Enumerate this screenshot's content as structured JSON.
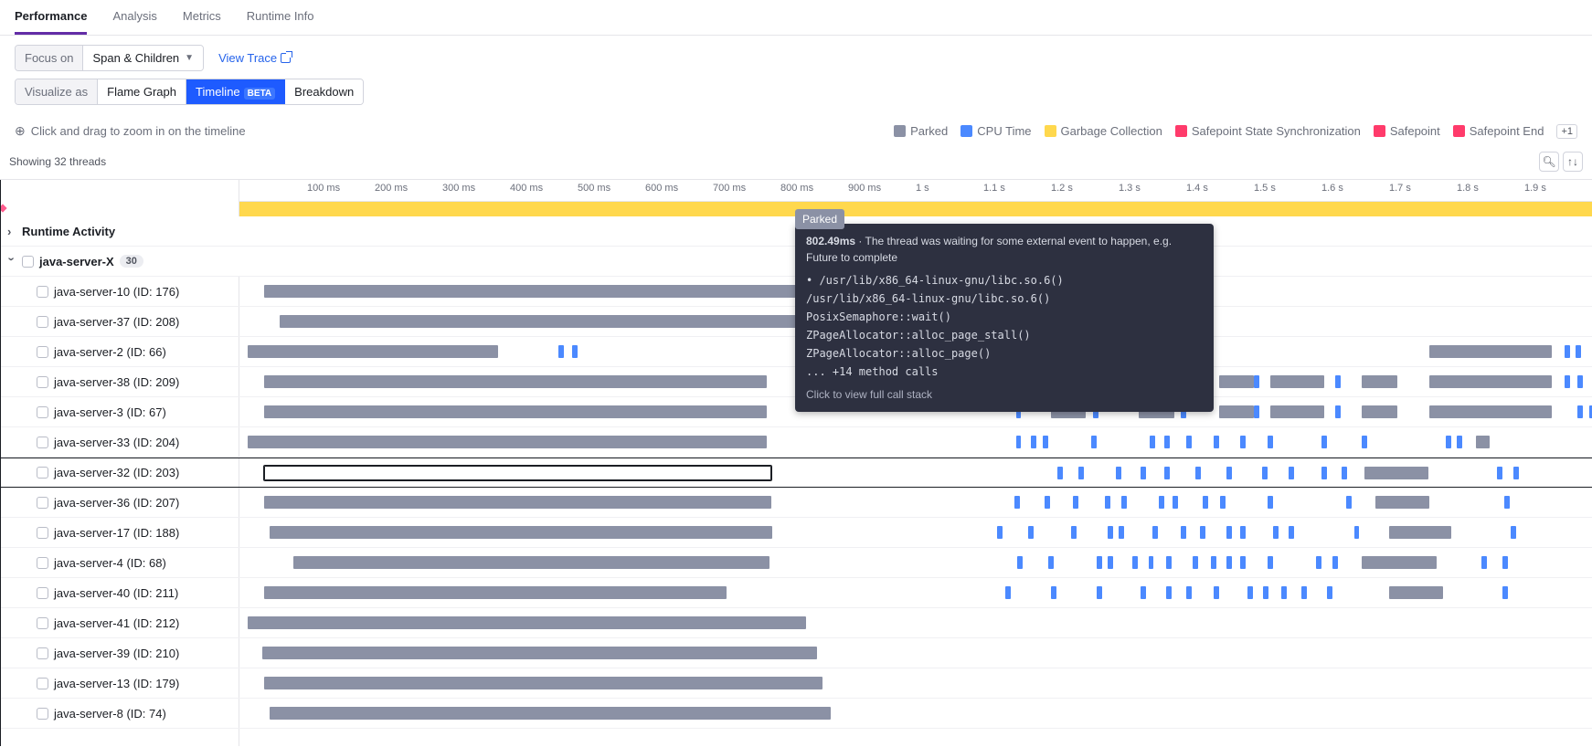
{
  "tabs": [
    "Performance",
    "Analysis",
    "Metrics",
    "Runtime Info"
  ],
  "activeTab": 0,
  "focusLabel": "Focus on",
  "focusValue": "Span & Children",
  "viewTrace": "View Trace",
  "visualizeLabel": "Visualize as",
  "vizOptions": {
    "flame": "Flame Graph",
    "timeline": "Timeline",
    "timelineBeta": "BETA",
    "breakdown": "Breakdown"
  },
  "zoomHint": "Click and drag to zoom in on the timeline",
  "legend": [
    {
      "name": "Parked",
      "color": "#8b91a5"
    },
    {
      "name": "CPU Time",
      "color": "#4b89ff"
    },
    {
      "name": "Garbage Collection",
      "color": "#ffd84d"
    },
    {
      "name": "Safepoint State Synchronization",
      "color": "#ff3b6b"
    },
    {
      "name": "Safepoint",
      "color": "#ff3b6b"
    },
    {
      "name": "Safepoint End",
      "color": "#ff3b6b"
    }
  ],
  "plusOne": "+1",
  "threadsCount": "Showing 32 threads",
  "ruler": [
    "100 ms",
    "200 ms",
    "300 ms",
    "400 ms",
    "500 ms",
    "600 ms",
    "700 ms",
    "800 ms",
    "900 ms",
    "1 s",
    "1.1 s",
    "1.2 s",
    "1.3 s",
    "1.4 s",
    "1.5 s",
    "1.6 s",
    "1.7 s",
    "1.8 s",
    "1.9 s"
  ],
  "runtimeActivity": "Runtime Activity",
  "group": {
    "name": "java-server-X",
    "count": "30"
  },
  "threads": [
    {
      "name": "java-server-10 (ID: 176)",
      "parked": [
        [
          1.8,
          57
        ]
      ],
      "cpu": []
    },
    {
      "name": "java-server-37 (ID: 208)",
      "parked": [
        [
          3,
          57
        ]
      ],
      "cpu": []
    },
    {
      "name": "java-server-2 (ID: 66)",
      "parked": [
        [
          0.6,
          18.5
        ],
        [
          88,
          9
        ]
      ],
      "cpu": [
        [
          23.6,
          0.4
        ],
        [
          24.6,
          0.4
        ],
        [
          54,
          0.5
        ],
        [
          55.3,
          0.4
        ],
        [
          56.3,
          0.4
        ],
        [
          57.2,
          0.4
        ],
        [
          58,
          0.4
        ],
        [
          98,
          0.4
        ],
        [
          98.8,
          0.4
        ],
        [
          101.5,
          0.4
        ],
        [
          102.4,
          0.4
        ]
      ]
    },
    {
      "name": "java-server-38 (ID: 209)",
      "parked": [
        [
          1.8,
          37.2
        ],
        [
          60,
          2.6
        ],
        [
          66.5,
          2.6
        ],
        [
          72.4,
          2.6
        ],
        [
          76.2,
          4
        ],
        [
          83,
          2.6
        ],
        [
          88,
          9
        ]
      ],
      "cpu": [
        [
          63.1,
          0.4
        ],
        [
          64,
          0.4
        ],
        [
          69.6,
          0.4
        ],
        [
          70.5,
          0.4
        ],
        [
          75,
          0.4
        ],
        [
          81,
          0.4
        ],
        [
          98,
          0.4
        ],
        [
          98.9,
          0.4
        ],
        [
          100.6,
          0.4
        ],
        [
          101.6,
          0.4
        ],
        [
          102.4,
          0.4
        ]
      ]
    },
    {
      "name": "java-server-3 (ID: 67)",
      "parked": [
        [
          1.8,
          37.2
        ],
        [
          60,
          2.6
        ],
        [
          66.5,
          2.6
        ],
        [
          72.4,
          2.6
        ],
        [
          76.2,
          4
        ],
        [
          83,
          2.6
        ],
        [
          88,
          9
        ]
      ],
      "cpu": [
        [
          57.4,
          0.4
        ],
        [
          63.1,
          0.4
        ],
        [
          69.6,
          0.4
        ],
        [
          75,
          0.4
        ],
        [
          81,
          0.4
        ],
        [
          98.9,
          0.4
        ],
        [
          99.8,
          0.4
        ],
        [
          101.6,
          0.4
        ]
      ]
    },
    {
      "name": "java-server-33 (ID: 204)",
      "parked": [
        [
          0.6,
          38.4
        ],
        [
          91.4,
          1
        ]
      ],
      "cpu": [
        [
          57.4,
          0.4
        ],
        [
          58.5,
          0.4
        ],
        [
          59.4,
          0.4
        ],
        [
          63,
          0.4
        ],
        [
          67.3,
          0.4
        ],
        [
          68.4,
          0.4
        ],
        [
          70,
          0.4
        ],
        [
          72,
          0.4
        ],
        [
          74,
          0.4
        ],
        [
          76,
          0.4
        ],
        [
          80,
          0.4
        ],
        [
          83,
          0.4
        ],
        [
          89.2,
          0.4
        ],
        [
          90,
          0.4
        ]
      ]
    },
    {
      "name": "java-server-32 (ID: 203)",
      "parked": [
        [
          1.8,
          37.5
        ],
        [
          83.2,
          4.7
        ]
      ],
      "cpu": [
        [
          60.5,
          0.4
        ],
        [
          62,
          0.4
        ],
        [
          64.8,
          0.4
        ],
        [
          66.6,
          0.4
        ],
        [
          68.4,
          0.4
        ],
        [
          70.7,
          0.4
        ],
        [
          73,
          0.4
        ],
        [
          75.6,
          0.4
        ],
        [
          77.6,
          0.4
        ],
        [
          80,
          0.4
        ],
        [
          81.5,
          0.4
        ],
        [
          93,
          0.4
        ],
        [
          94.2,
          0.4
        ]
      ]
    },
    {
      "name": "java-server-36 (ID: 207)",
      "parked": [
        [
          1.8,
          37.5
        ],
        [
          84,
          4
        ]
      ],
      "cpu": [
        [
          57.3,
          0.4
        ],
        [
          59.5,
          0.4
        ],
        [
          61.6,
          0.4
        ],
        [
          64,
          0.4
        ],
        [
          65.2,
          0.4
        ],
        [
          68,
          0.4
        ],
        [
          69,
          0.4
        ],
        [
          71.2,
          0.4
        ],
        [
          72.5,
          0.4
        ],
        [
          76,
          0.4
        ],
        [
          81.8,
          0.4
        ],
        [
          93.5,
          0.4
        ]
      ]
    },
    {
      "name": "java-server-17 (ID: 188)",
      "parked": [
        [
          2.2,
          37.2
        ],
        [
          85,
          4.6
        ]
      ],
      "cpu": [
        [
          56,
          0.4
        ],
        [
          58.3,
          0.4
        ],
        [
          61.5,
          0.4
        ],
        [
          64.2,
          0.4
        ],
        [
          65,
          0.4
        ],
        [
          67.5,
          0.4
        ],
        [
          69.6,
          0.4
        ],
        [
          71,
          0.4
        ],
        [
          73,
          0.4
        ],
        [
          74,
          0.4
        ],
        [
          76.4,
          0.4
        ],
        [
          77.6,
          0.4
        ],
        [
          82.4,
          0.4
        ],
        [
          94,
          0.4
        ]
      ]
    },
    {
      "name": "java-server-4 (ID: 68)",
      "parked": [
        [
          4,
          35.2
        ],
        [
          83,
          5.5
        ]
      ],
      "cpu": [
        [
          57.5,
          0.4
        ],
        [
          59.8,
          0.4
        ],
        [
          63.4,
          0.4
        ],
        [
          64.2,
          0.4
        ],
        [
          66,
          0.4
        ],
        [
          67.2,
          0.4
        ],
        [
          68.5,
          0.4
        ],
        [
          70.5,
          0.4
        ],
        [
          71.8,
          0.4
        ],
        [
          73,
          0.4
        ],
        [
          74,
          0.4
        ],
        [
          76,
          0.4
        ],
        [
          79.6,
          0.4
        ],
        [
          80.8,
          0.4
        ],
        [
          91.8,
          0.4
        ],
        [
          93.4,
          0.4
        ]
      ]
    },
    {
      "name": "java-server-40 (ID: 211)",
      "parked": [
        [
          1.8,
          34.2
        ],
        [
          85,
          4
        ]
      ],
      "cpu": [
        [
          56.6,
          0.4
        ],
        [
          60,
          0.4
        ],
        [
          63.4,
          0.4
        ],
        [
          66.6,
          0.4
        ],
        [
          68.5,
          0.4
        ],
        [
          70,
          0.4
        ],
        [
          72,
          0.4
        ],
        [
          74.5,
          0.4
        ],
        [
          75.7,
          0.4
        ],
        [
          77,
          0.4
        ],
        [
          78.5,
          0.4
        ],
        [
          80.4,
          0.4
        ],
        [
          93.4,
          0.4
        ]
      ]
    },
    {
      "name": "java-server-41 (ID: 212)",
      "parked": [
        [
          0.6,
          41.3
        ]
      ],
      "cpu": []
    },
    {
      "name": "java-server-39 (ID: 210)",
      "parked": [
        [
          1.7,
          41
        ]
      ],
      "cpu": []
    },
    {
      "name": "java-server-13 (ID: 179)",
      "parked": [
        [
          1.8,
          41.3
        ]
      ],
      "cpu": []
    },
    {
      "name": "java-server-8 (ID: 74)",
      "parked": [
        [
          2.2,
          41.5
        ]
      ],
      "cpu": []
    }
  ],
  "highlightedRow": 6,
  "vlinePercent": 23.9,
  "tooltip": {
    "pill": "Parked",
    "time": "802.49ms",
    "desc": "The thread was waiting for some external event to happen, e.g. Future to complete",
    "stack": [
      "/usr/lib/x86_64-linux-gnu/libc.so.6()",
      "/usr/lib/x86_64-linux-gnu/libc.so.6()",
      "PosixSemaphore::wait()",
      "ZPageAllocator::alloc_page_stall()",
      "ZPageAllocator::alloc_page()",
      "... +14 method calls"
    ],
    "cta": "Click to view full call stack"
  }
}
